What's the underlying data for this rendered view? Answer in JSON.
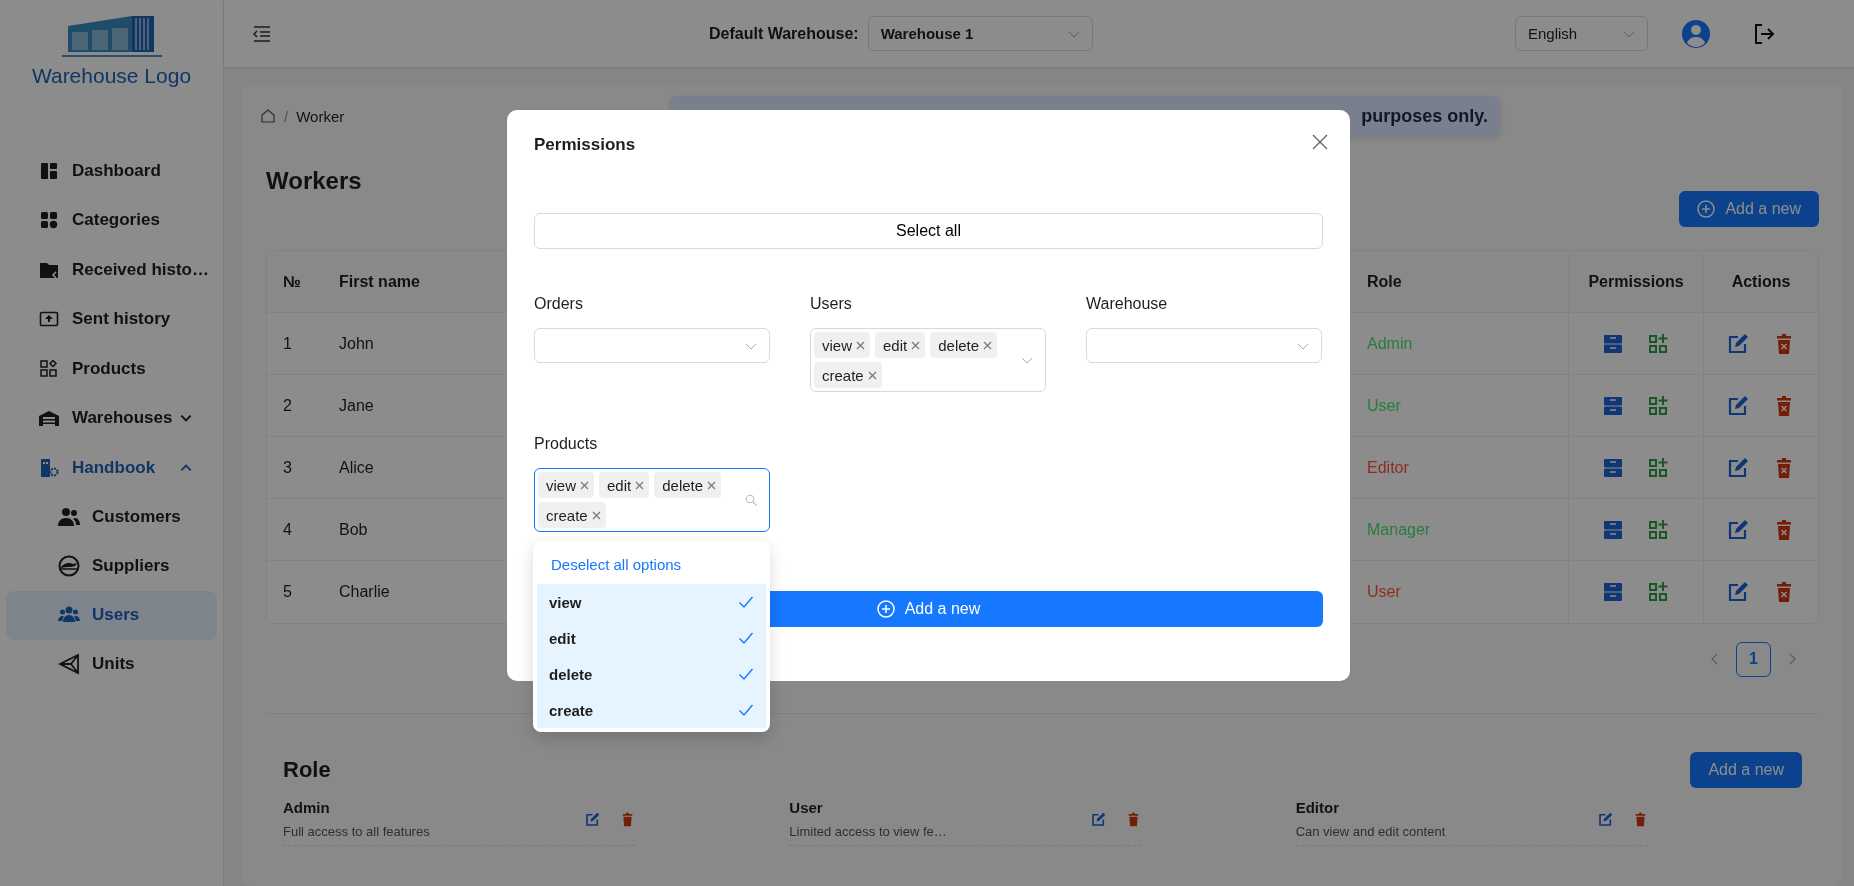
{
  "sidebar": {
    "logo_text": "Warehouse Logo",
    "items": [
      {
        "label": "Dashboard",
        "selected": false
      },
      {
        "label": "Categories",
        "selected": false
      },
      {
        "label": "Received histo…",
        "selected": false
      },
      {
        "label": "Sent history",
        "selected": false
      },
      {
        "label": "Products",
        "selected": false
      },
      {
        "label": "Warehouses",
        "selected": false,
        "expanded": false
      },
      {
        "label": "Handbook",
        "selected": false,
        "expanded": true,
        "children": [
          {
            "label": "Customers",
            "selected": false
          },
          {
            "label": "Suppliers",
            "selected": false
          },
          {
            "label": "Users",
            "selected": true
          },
          {
            "label": "Units",
            "selected": false
          }
        ]
      }
    ]
  },
  "header": {
    "warehouse_label": "Default Warehouse:",
    "warehouse_value": "Warehouse 1",
    "language": "English"
  },
  "breadcrumb": {
    "separator": "/",
    "current": "Worker"
  },
  "notice": {
    "text": "purposes only."
  },
  "workers": {
    "title": "Workers",
    "add_button": "Add a new",
    "columns": [
      "№",
      "First name",
      "Role",
      "Permissions",
      "Actions"
    ],
    "rows": [
      {
        "number": "1",
        "first_name": "John",
        "role": "Admin",
        "color": "#267d3c"
      },
      {
        "number": "2",
        "first_name": "Jane",
        "role": "User",
        "color": "#267d3c"
      },
      {
        "number": "3",
        "first_name": "Alice",
        "role": "Editor",
        "color": "#8c2d1e"
      },
      {
        "number": "4",
        "first_name": "Bob",
        "role": "Manager",
        "color": "#267d3c"
      },
      {
        "number": "5",
        "first_name": "Charlie",
        "role": "User",
        "color": "#8c2d1e"
      }
    ],
    "pages": [
      {
        "label": "1",
        "selected": true
      }
    ]
  },
  "roles": {
    "title": "Role",
    "add_button": "Add a new",
    "items": [
      {
        "name": "Admin",
        "description": "Full access to all features"
      },
      {
        "name": "User",
        "description": "Limited access to view fe…"
      },
      {
        "name": "Editor",
        "description": "Can view and edit content"
      }
    ]
  },
  "modal": {
    "title": "Permissions",
    "select_all": "Select all",
    "fields": [
      {
        "label": "Orders",
        "focused": false
      },
      {
        "label": "Users",
        "focused": false,
        "tags": [
          "view",
          "edit",
          "delete",
          "create"
        ]
      },
      {
        "label": "Warehouse",
        "focused": false
      },
      {
        "label": "Products",
        "focused": true,
        "tags": [
          "view",
          "edit",
          "delete",
          "create"
        ]
      }
    ],
    "dropdown": {
      "action": "Deselect all options",
      "options": [
        {
          "label": "view",
          "selected": true
        },
        {
          "label": "edit",
          "selected": true
        },
        {
          "label": "delete",
          "selected": true
        },
        {
          "label": "create",
          "selected": true
        }
      ]
    },
    "add_button": "Add a new"
  }
}
